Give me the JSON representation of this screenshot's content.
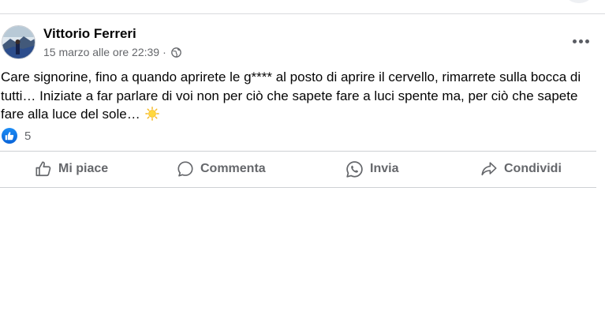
{
  "post": {
    "author": "Vittorio Ferreri",
    "timestamp": "15 marzo alle ore 22:39",
    "separator": "·",
    "privacy_icon": "globe-icon",
    "text": "Care signorine, fino a quando aprirete le g**** al posto di aprire il cervello, rimarrete sulla bocca di tutti… Iniziate a far parlare di voi non per ciò che sapete fare a luci spente ma, per ciò che sapete fare alla luce del sole…",
    "emoji": "sun-emoji"
  },
  "reactions": {
    "icon": "like-icon",
    "count": "5"
  },
  "actions": {
    "like": "Mi piace",
    "comment": "Commenta",
    "send": "Invia",
    "share": "Condividi"
  },
  "colors": {
    "secondary_text": "#65676b",
    "like_blue": "#1877f2",
    "divider": "#ced0d4"
  }
}
